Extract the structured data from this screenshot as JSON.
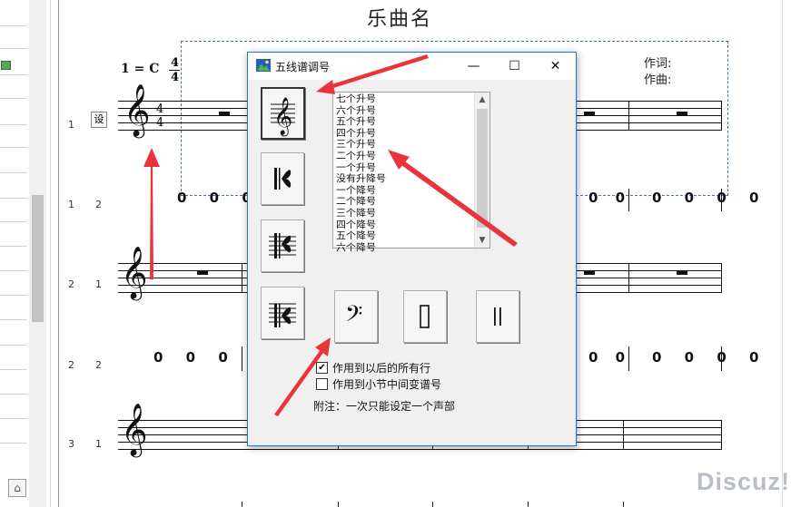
{
  "score": {
    "title": "乐曲名",
    "tempo": "1 = C",
    "time_signature": {
      "top": "4",
      "bottom": "4"
    },
    "lyricist_label": "作词:",
    "composer_label": "作曲:",
    "set_badge": "设",
    "row_labels": [
      {
        "a": "1",
        "b": ""
      },
      {
        "a": "1",
        "b": "2"
      },
      {
        "a": "2",
        "b": "1"
      },
      {
        "a": "2",
        "b": "2"
      },
      {
        "a": "3",
        "b": "1"
      }
    ],
    "numbered_notes": "0 0 0 0"
  },
  "dialog": {
    "title": "五线谱调号",
    "window_buttons": {
      "minimize": "—",
      "maximize": "☐",
      "close": "✕"
    },
    "key_signatures": [
      "七个升号",
      "六个升号",
      "五个升号",
      "四个升号",
      "三个升号",
      "二个升号",
      "一个升号",
      "没有升降号",
      "一个降号",
      "二个降号",
      "三个降号",
      "四个降号",
      "五个降号",
      "六个降号"
    ],
    "checkbox_all_rows": {
      "label": "作用到以后的所有行",
      "checked": true,
      "mark": "✔"
    },
    "checkbox_mid_measure": {
      "label": "作用到小节中间变谱号",
      "checked": false,
      "mark": ""
    },
    "note": "附注：一次只能设定一个声部",
    "clef_buttons": [
      "treble-clef",
      "alto-clef",
      "tenor-clef",
      "baritone-clef",
      "bass-clef",
      "percussion-clef",
      "double-bar"
    ]
  },
  "left_panel": {
    "home_icon": "⌂"
  },
  "watermark": "Discuz!",
  "colors": {
    "dialog_border": "#1b77d3",
    "arrow": "#e8343a",
    "selection": "#4a6ecf"
  }
}
